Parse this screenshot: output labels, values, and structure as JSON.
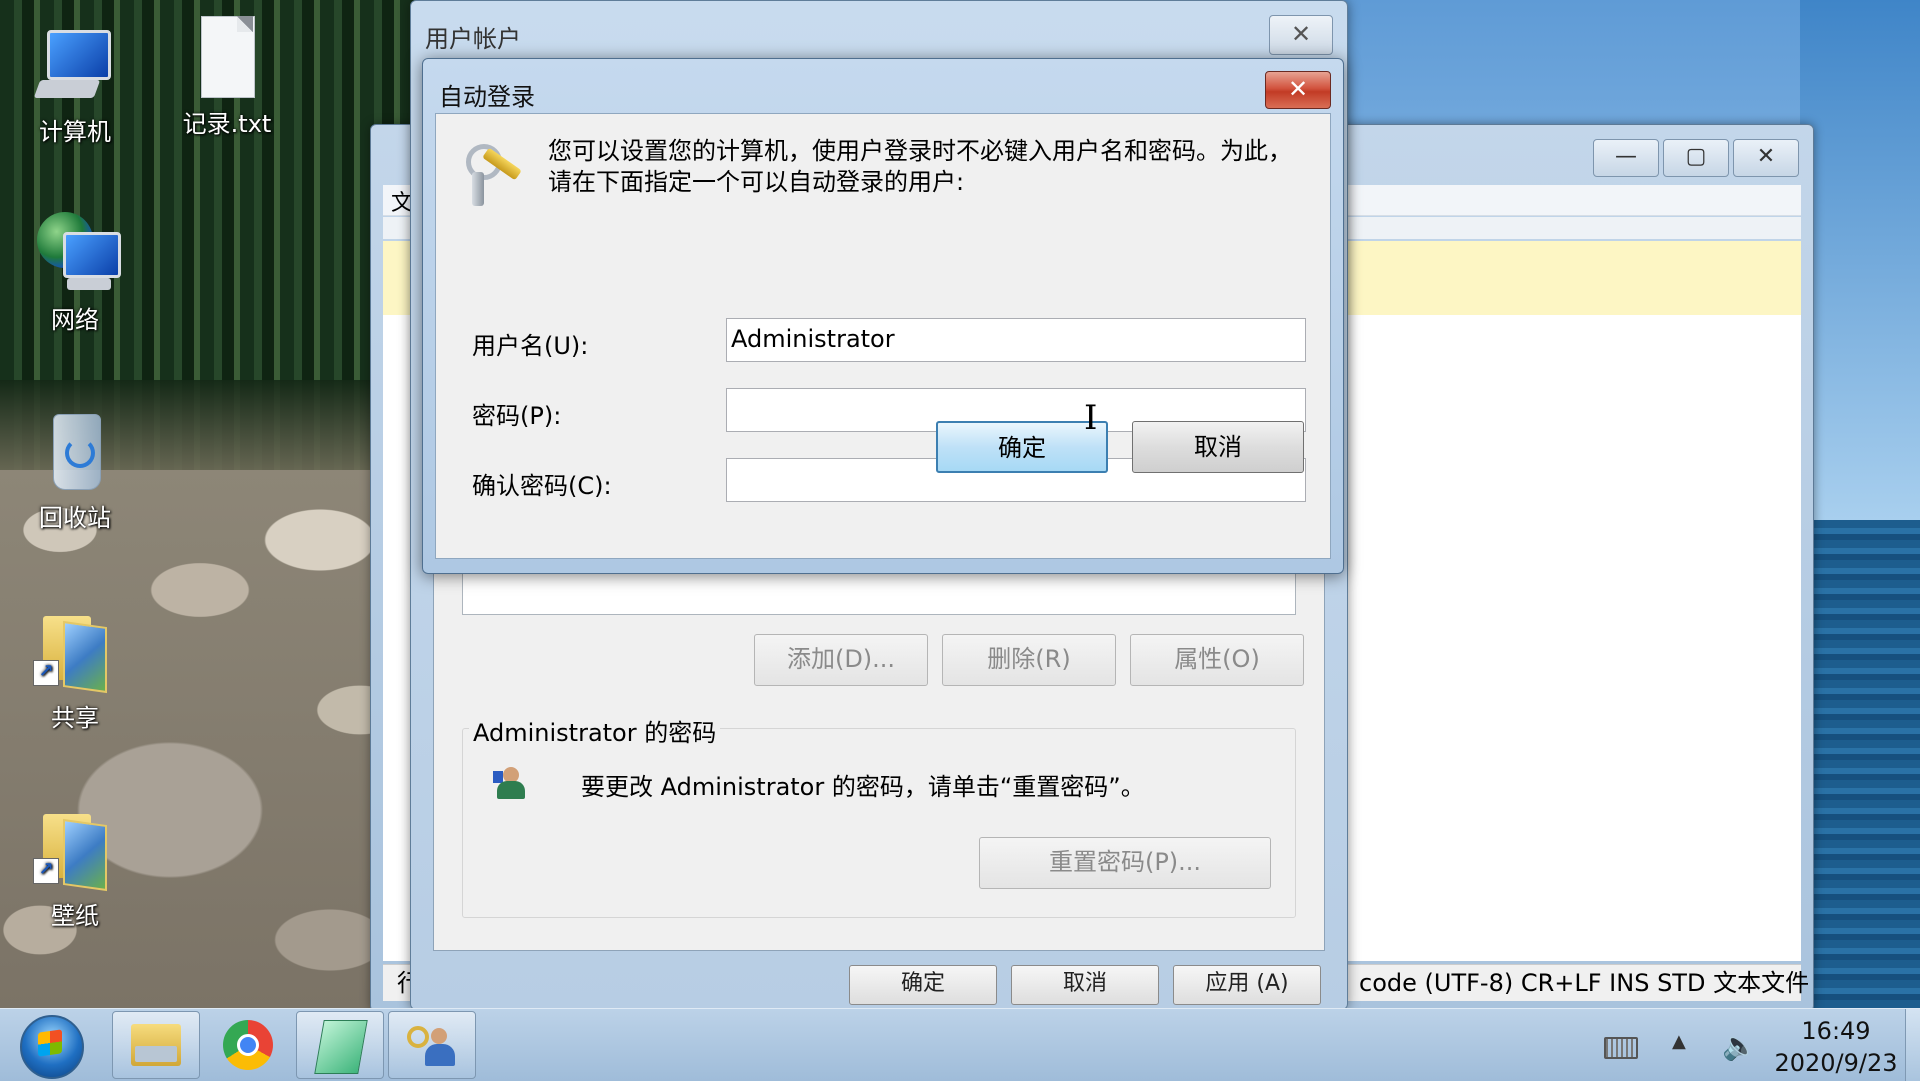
{
  "desktop": {
    "icons": [
      {
        "label": "计算机",
        "icon": "computer-icon"
      },
      {
        "label": "记录.txt",
        "icon": "text-file-icon"
      },
      {
        "label": "网络",
        "icon": "network-icon"
      },
      {
        "label": "回收站",
        "icon": "recycle-bin-icon"
      },
      {
        "label": "共享",
        "icon": "folder-shortcut-icon"
      },
      {
        "label": "壁纸",
        "icon": "folder-shortcut-icon"
      }
    ]
  },
  "notepad": {
    "status": "code (UTF-8) CR+LF INS STD 文本文件",
    "status_left": "行",
    "menu_partial": "文"
  },
  "user_accounts": {
    "title": "用户帐户",
    "buttons": {
      "add": "添加(D)...",
      "remove": "删除(R)",
      "properties": "属性(O)"
    },
    "password_group": {
      "label": "Administrator 的密码",
      "text": "要更改 Administrator 的密码，请单击“重置密码”。",
      "reset_button": "重置密码(P)..."
    },
    "bottom": {
      "ok": "确定",
      "cancel": "取消",
      "apply": "应用 (A)"
    }
  },
  "auto_logon": {
    "title": "自动登录",
    "description": "您可以设置您的计算机，使用户登录时不必键入用户名和密码。为此，请在下面指定一个可以自动登录的用户:",
    "fields": {
      "username_label": "用户名(U):",
      "username_value": "Administrator",
      "password_label": "密码(P):",
      "password_value": "",
      "confirm_label": "确认密码(C):",
      "confirm_value": ""
    },
    "ok": "确定",
    "cancel": "取消"
  },
  "taskbar": {
    "clock_time": "16:49",
    "clock_date": "2020/9/23"
  },
  "colors": {
    "close_button": "#c23b25",
    "ok_button_border": "#3c7fb1",
    "notepad_highlight": "#fdf6c4"
  }
}
